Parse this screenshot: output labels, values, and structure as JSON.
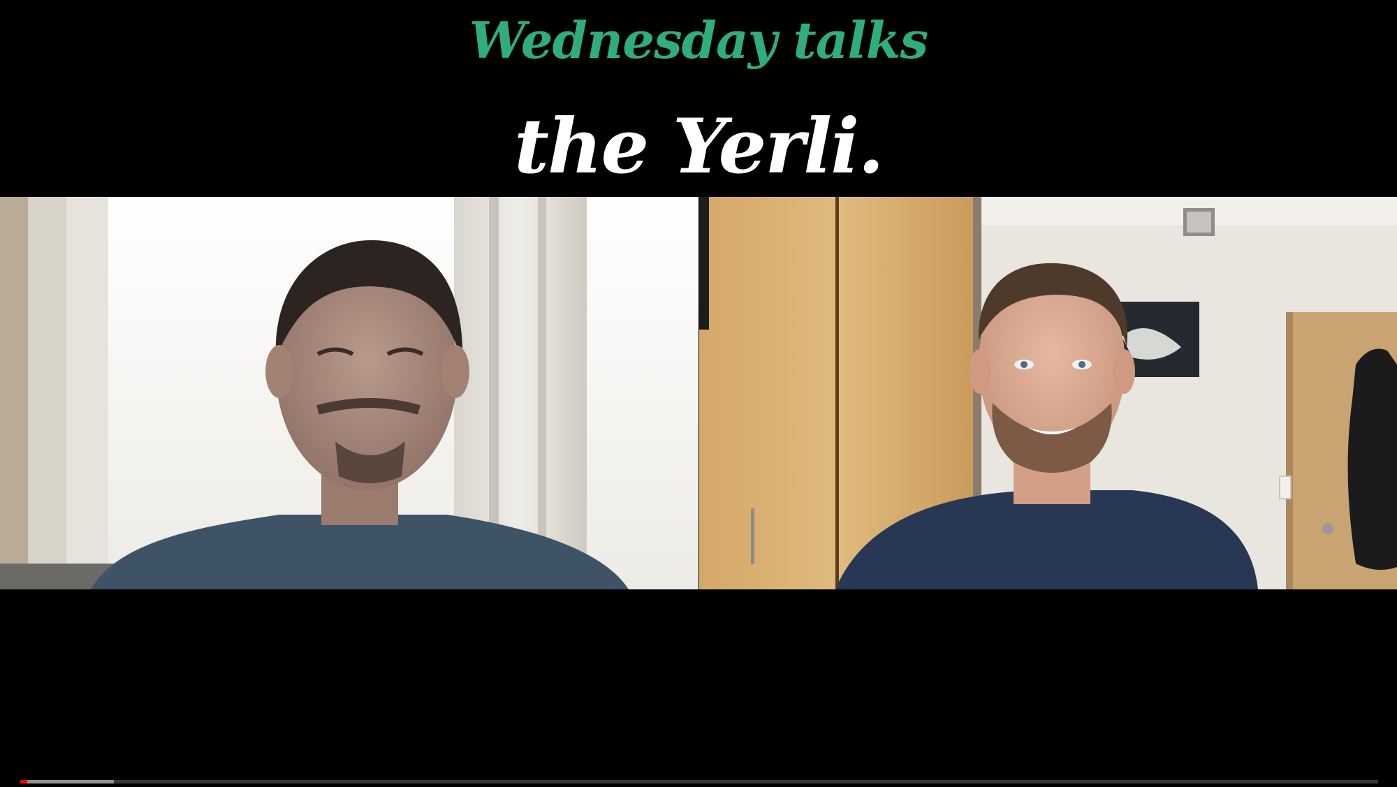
{
  "video": {
    "title_top": "Wednesday talks",
    "title_main": "the Yerli."
  },
  "participants": [
    {
      "slot": "left",
      "description": "smiling man, navy t-shirt, bright window with curtains behind"
    },
    {
      "slot": "right",
      "description": "smiling man, navy henley, wooden wardrobe and framed poster behind"
    }
  ],
  "progress": {
    "played_fraction": 0.004,
    "buffered_fraction": 0.069
  },
  "colors": {
    "background": "#000000",
    "title_top": "#2fae7c",
    "title_main": "#ffffff",
    "progress_played": "#ff0000"
  },
  "icons": {
    "left_feed": "person-video-feed",
    "right_feed": "person-video-feed"
  }
}
